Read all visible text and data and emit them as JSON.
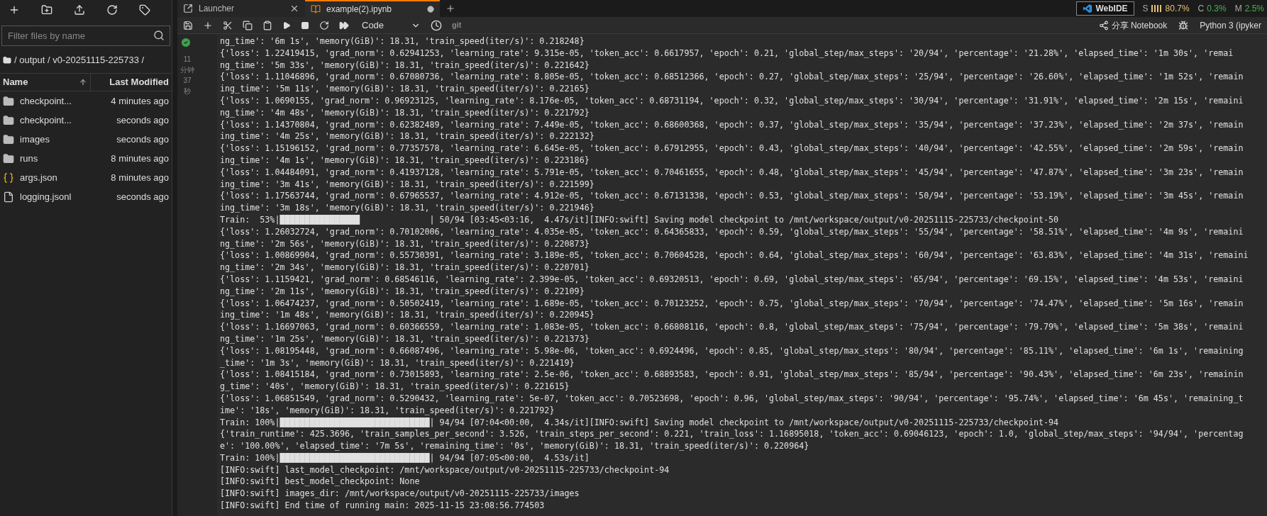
{
  "file_browser": {
    "filter": {
      "placeholder": "Filter files by name"
    },
    "breadcrumb": "/ output / v0-20251115-225733 /",
    "columns": [
      {
        "label": "Name",
        "sorted": true
      },
      {
        "label": "Last Modified"
      }
    ],
    "files": [
      {
        "kind": "folder",
        "name": "checkpoint...",
        "modified": "4 minutes ago"
      },
      {
        "kind": "folder",
        "name": "checkpoint...",
        "modified": "seconds ago"
      },
      {
        "kind": "folder",
        "name": "images",
        "modified": "seconds ago"
      },
      {
        "kind": "folder",
        "name": "runs",
        "modified": "8 minutes ago"
      },
      {
        "kind": "json",
        "name": "args.json",
        "modified": "8 minutes ago"
      },
      {
        "kind": "file",
        "name": "logging.jsonl",
        "modified": "seconds ago"
      }
    ]
  },
  "tabs": [
    {
      "kind": "launcher",
      "label": "Launcher",
      "selected": false,
      "unsaved": false
    },
    {
      "kind": "notebook",
      "label": "example(2).ipynb",
      "selected": true,
      "unsaved": true
    }
  ],
  "status": {
    "webide": "WebIDE",
    "meters": [
      {
        "label": "S",
        "value": "80.7%",
        "color": "#e5c07b",
        "bars": true
      },
      {
        "label": "C",
        "value": "0.3%",
        "color": "#4caf50"
      },
      {
        "label": "M",
        "value": "2.5%",
        "color": "#4caf50"
      }
    ]
  },
  "toolbar": {
    "cell_type": "Code",
    "git": "git",
    "share": "分享 Notebook",
    "kernel": "Python 3 (ipyker"
  },
  "cell": {
    "succeeded": true,
    "time": "11分钟37秒",
    "output": [
      "ng_time': '6m 1s', 'memory(GiB)': 18.31, 'train_speed(iter/s)': 0.218248}",
      "{'loss': 1.22419415, 'grad_norm': 0.62941253, 'learning_rate': 9.315e-05, 'token_acc': 0.6617957, 'epoch': 0.21, 'global_step/max_steps': '20/94', 'percentage': '21.28%', 'elapsed_time': '1m 30s', 'remai",
      "ng_time': '5m 33s', 'memory(GiB)': 18.31, 'train_speed(iter/s)': 0.221642}",
      "{'loss': 1.11046896, 'grad_norm': 0.67080736, 'learning_rate': 8.805e-05, 'token_acc': 0.68512366, 'epoch': 0.27, 'global_step/max_steps': '25/94', 'percentage': '26.60%', 'elapsed_time': '1m 52s', 'remain",
      "ing_time': '5m 11s', 'memory(GiB)': 18.31, 'train_speed(iter/s)': 0.22165}",
      "{'loss': 1.0690155, 'grad_norm': 0.96923125, 'learning_rate': 8.176e-05, 'token_acc': 0.68731194, 'epoch': 0.32, 'global_step/max_steps': '30/94', 'percentage': '31.91%', 'elapsed_time': '2m 15s', 'remaini",
      "ng_time': '4m 48s', 'memory(GiB)': 18.31, 'train_speed(iter/s)': 0.221792}",
      "{'loss': 1.14370804, 'grad_norm': 0.62382489, 'learning_rate': 7.449e-05, 'token_acc': 0.68600368, 'epoch': 0.37, 'global_step/max_steps': '35/94', 'percentage': '37.23%', 'elapsed_time': '2m 37s', 'remain",
      "ing_time': '4m 25s', 'memory(GiB)': 18.31, 'train_speed(iter/s)': 0.222132}",
      "{'loss': 1.15196152, 'grad_norm': 0.77357578, 'learning_rate': 6.645e-05, 'token_acc': 0.67912955, 'epoch': 0.43, 'global_step/max_steps': '40/94', 'percentage': '42.55%', 'elapsed_time': '2m 59s', 'remain",
      "ing_time': '4m 1s', 'memory(GiB)': 18.31, 'train_speed(iter/s)': 0.223186}",
      "{'loss': 1.04484091, 'grad_norm': 0.41937128, 'learning_rate': 5.791e-05, 'token_acc': 0.70461655, 'epoch': 0.48, 'global_step/max_steps': '45/94', 'percentage': '47.87%', 'elapsed_time': '3m 23s', 'remain",
      "ing_time': '3m 41s', 'memory(GiB)': 18.31, 'train_speed(iter/s)': 0.221599}",
      "{'loss': 1.17563744, 'grad_norm': 0.67965537, 'learning_rate': 4.912e-05, 'token_acc': 0.67131338, 'epoch': 0.53, 'global_step/max_steps': '50/94', 'percentage': '53.19%', 'elapsed_time': '3m 45s', 'remain",
      "ing_time': '3m 18s', 'memory(GiB)': 18.31, 'train_speed(iter/s)': 0.221946}",
      "Train:  53%|████████████████              | 50/94 [03:45<03:16,  4.47s/it][INFO:swift] Saving model checkpoint to /mnt/workspace/output/v0-20251115-225733/checkpoint-50",
      "{'loss': 1.26032724, 'grad_norm': 0.70102006, 'learning_rate': 4.035e-05, 'token_acc': 0.64365833, 'epoch': 0.59, 'global_step/max_steps': '55/94', 'percentage': '58.51%', 'elapsed_time': '4m 9s', 'remaini",
      "ng_time': '2m 56s', 'memory(GiB)': 18.31, 'train_speed(iter/s)': 0.220873}",
      "{'loss': 1.00869904, 'grad_norm': 0.55730391, 'learning_rate': 3.189e-05, 'token_acc': 0.70604528, 'epoch': 0.64, 'global_step/max_steps': '60/94', 'percentage': '63.83%', 'elapsed_time': '4m 31s', 'remaini",
      "ng_time': '2m 34s', 'memory(GiB)': 18.31, 'train_speed(iter/s)': 0.220701}",
      "{'loss': 1.1159421, 'grad_norm': 0.68546116, 'learning_rate': 2.399e-05, 'token_acc': 0.69320513, 'epoch': 0.69, 'global_step/max_steps': '65/94', 'percentage': '69.15%', 'elapsed_time': '4m 53s', 'remaini",
      "ng_time': '2m 11s', 'memory(GiB)': 18.31, 'train_speed(iter/s)': 0.22109}",
      "{'loss': 1.06474237, 'grad_norm': 0.50502419, 'learning_rate': 1.689e-05, 'token_acc': 0.70123252, 'epoch': 0.75, 'global_step/max_steps': '70/94', 'percentage': '74.47%', 'elapsed_time': '5m 16s', 'remain",
      "ing_time': '1m 48s', 'memory(GiB)': 18.31, 'train_speed(iter/s)': 0.220945}",
      "{'loss': 1.16697063, 'grad_norm': 0.60366559, 'learning_rate': 1.083e-05, 'token_acc': 0.66808116, 'epoch': 0.8, 'global_step/max_steps': '75/94', 'percentage': '79.79%', 'elapsed_time': '5m 38s', 'remaini",
      "ng_time': '1m 25s', 'memory(GiB)': 18.31, 'train_speed(iter/s)': 0.221373}",
      "{'loss': 1.08195448, 'grad_norm': 0.66087496, 'learning_rate': 5.98e-06, 'token_acc': 0.6924496, 'epoch': 0.85, 'global_step/max_steps': '80/94', 'percentage': '85.11%', 'elapsed_time': '6m 1s', 'remaining",
      "_time': '1m 3s', 'memory(GiB)': 18.31, 'train_speed(iter/s)': 0.221419}",
      "{'loss': 1.08415184, 'grad_norm': 0.73015893, 'learning_rate': 2.5e-06, 'token_acc': 0.68893583, 'epoch': 0.91, 'global_step/max_steps': '85/94', 'percentage': '90.43%', 'elapsed_time': '6m 23s', 'remainin",
      "g_time': '40s', 'memory(GiB)': 18.31, 'train_speed(iter/s)': 0.221615}",
      "{'loss': 1.06851549, 'grad_norm': 0.5290432, 'learning_rate': 5e-07, 'token_acc': 0.70523698, 'epoch': 0.96, 'global_step/max_steps': '90/94', 'percentage': '95.74%', 'elapsed_time': '6m 45s', 'remaining_t",
      "ime': '18s', 'memory(GiB)': 18.31, 'train_speed(iter/s)': 0.221792}",
      "Train: 100%|██████████████████████████████| 94/94 [07:04<00:00,  4.34s/it][INFO:swift] Saving model checkpoint to /mnt/workspace/output/v0-20251115-225733/checkpoint-94",
      "{'train_runtime': 425.3696, 'train_samples_per_second': 3.526, 'train_steps_per_second': 0.221, 'train_loss': 1.16895018, 'token_acc': 0.69046123, 'epoch': 1.0, 'global_step/max_steps': '94/94', 'percentag",
      "e': '100.00%', 'elapsed_time': '7m 5s', 'remaining_time': '0s', 'memory(GiB)': 18.31, 'train_speed(iter/s)': 0.220964}",
      "Train: 100%|██████████████████████████████| 94/94 [07:05<00:00,  4.53s/it]",
      "[INFO:swift] last_model_checkpoint: /mnt/workspace/output/v0-20251115-225733/checkpoint-94",
      "[INFO:swift] best_model_checkpoint: None",
      "[INFO:swift] images_dir: /mnt/workspace/output/v0-20251115-225733/images",
      "[INFO:swift] End time of running main: 2025-11-15 23:08:56.774503"
    ]
  }
}
